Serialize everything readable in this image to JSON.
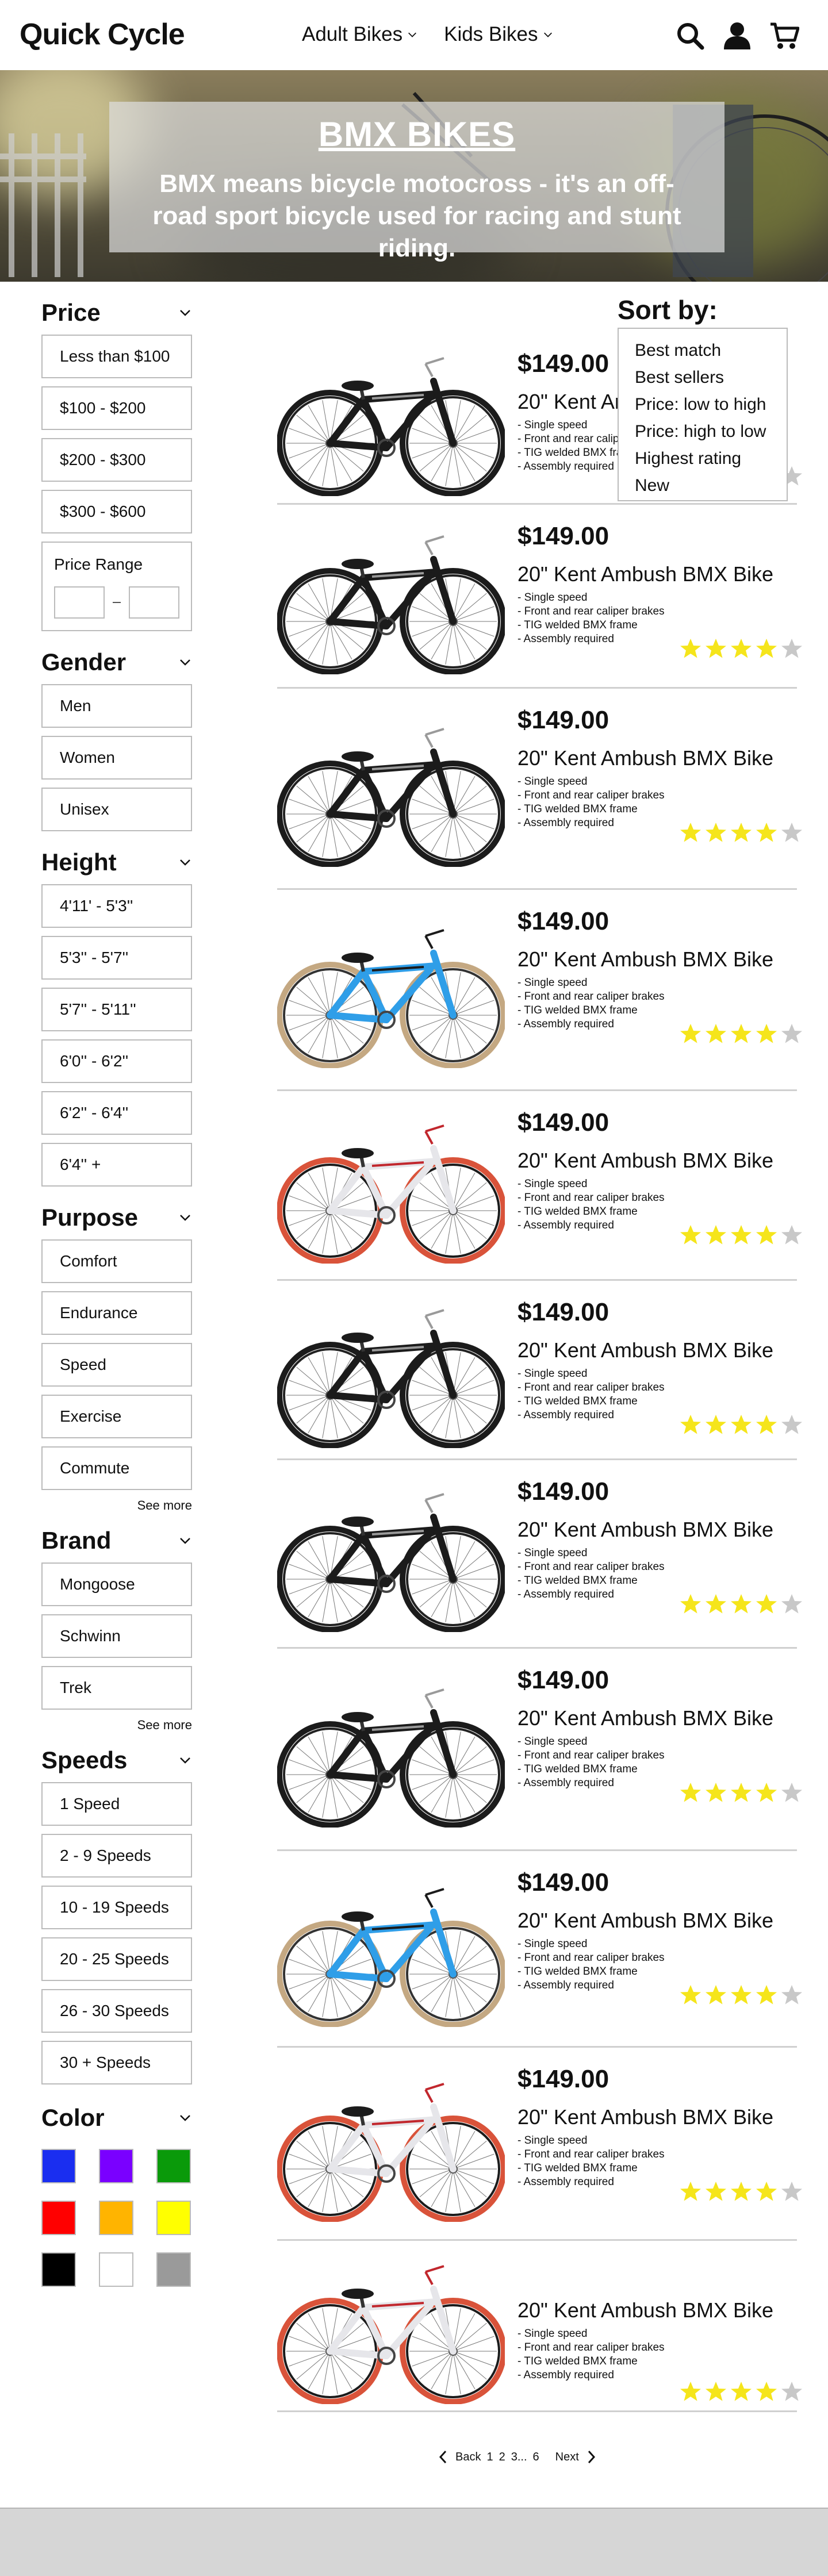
{
  "header": {
    "logo": "Quick Cycle",
    "nav": [
      {
        "label": "Adult Bikes"
      },
      {
        "label": "Kids Bikes"
      }
    ],
    "icons": [
      "search-icon",
      "user-icon",
      "cart-icon"
    ]
  },
  "hero": {
    "title": "BMX BIKES",
    "subtitle": "BMX means bicycle motocross - it's an off-road sport bicycle used for racing and stunt riding."
  },
  "filters": {
    "price": {
      "title": "Price",
      "options": [
        "Less than $100",
        "$100 - $200",
        "$200 - $300",
        "$300 - $600"
      ],
      "range_label": "Price Range"
    },
    "gender": {
      "title": "Gender",
      "options": [
        "Men",
        "Women",
        "Unisex"
      ]
    },
    "height": {
      "title": "Height",
      "options": [
        "4'11' - 5'3''",
        "5'3'' - 5'7''",
        "5'7'' - 5'11''",
        "6'0'' - 6'2''",
        "6'2'' - 6'4''",
        "6'4'' +"
      ]
    },
    "purpose": {
      "title": "Purpose",
      "options": [
        "Comfort",
        "Endurance",
        "Speed",
        "Exercise",
        "Commute"
      ],
      "see_more": "See more"
    },
    "brand": {
      "title": "Brand",
      "options": [
        "Mongoose",
        "Schwinn",
        "Trek"
      ],
      "see_more": "See more"
    },
    "speeds": {
      "title": "Speeds",
      "options": [
        "1 Speed",
        "2 - 9 Speeds",
        "10 - 19 Speeds",
        "20 - 25 Speeds",
        "26 - 30 Speeds",
        "30 + Speeds"
      ]
    },
    "color": {
      "title": "Color",
      "swatches": [
        "#1a2ef0",
        "#7a00ff",
        "#0a9a0a",
        "#ff0000",
        "#ffb400",
        "#ffff00",
        "#000000",
        "#ffffff",
        "#9a9a9a"
      ]
    }
  },
  "sort": {
    "label": "Sort by:",
    "options": [
      "Best match",
      "Best sellers",
      "Price: low to high",
      "Price: high to low",
      "Highest rating",
      "New"
    ]
  },
  "products": [
    {
      "price": "$149.00",
      "name": "20\" Kent Ambush BMX Bike",
      "features": [
        "- Single speed",
        "- Front and rear caliper brakes",
        "- TIG welded BMX frame",
        "- Assembly required"
      ],
      "rating": 4,
      "color": "black"
    },
    {
      "price": "$149.00",
      "name": "20\" Kent Ambush BMX Bike",
      "features": [
        "- Single speed",
        "- Front and rear caliper brakes",
        "- TIG welded BMX frame",
        "- Assembly required"
      ],
      "rating": 4,
      "color": "black"
    },
    {
      "price": "$149.00",
      "name": "20\" Kent Ambush BMX Bike",
      "features": [
        "- Single speed",
        "- Front and rear caliper brakes",
        "- TIG welded BMX frame",
        "- Assembly required"
      ],
      "rating": 4,
      "color": "black"
    },
    {
      "price": "$149.00",
      "name": "20\" Kent Ambush BMX Bike",
      "features": [
        "- Single speed",
        "- Front and rear caliper brakes",
        "- TIG welded BMX frame",
        "- Assembly required"
      ],
      "rating": 4,
      "color": "blue"
    },
    {
      "price": "$149.00",
      "name": "20\" Kent Ambush BMX Bike",
      "features": [
        "- Single speed",
        "- Front and rear caliper brakes",
        "- TIG welded BMX frame",
        "- Assembly required"
      ],
      "rating": 4,
      "color": "white"
    },
    {
      "price": "$149.00",
      "name": "20\" Kent Ambush BMX Bike",
      "features": [
        "- Single speed",
        "- Front and rear caliper brakes",
        "- TIG welded BMX frame",
        "- Assembly required"
      ],
      "rating": 4,
      "color": "black"
    },
    {
      "price": "$149.00",
      "name": "20\" Kent Ambush BMX Bike",
      "features": [
        "- Single speed",
        "- Front and rear caliper brakes",
        "- TIG welded BMX frame",
        "- Assembly required"
      ],
      "rating": 4,
      "color": "black"
    },
    {
      "price": "$149.00",
      "name": "20\" Kent Ambush BMX Bike",
      "features": [
        "- Single speed",
        "- Front and rear caliper brakes",
        "- TIG welded BMX frame",
        "- Assembly required"
      ],
      "rating": 4,
      "color": "black"
    },
    {
      "price": "$149.00",
      "name": "20\" Kent Ambush BMX Bike",
      "features": [
        "- Single speed",
        "- Front and rear caliper brakes",
        "- TIG welded BMX frame",
        "- Assembly required"
      ],
      "rating": 4,
      "color": "blue"
    },
    {
      "price": "$149.00",
      "name": "20\" Kent Ambush BMX Bike",
      "features": [
        "- Single speed",
        "- Front and rear caliper brakes",
        "- TIG welded BMX frame",
        "- Assembly required"
      ],
      "rating": 4,
      "color": "white"
    },
    {
      "price": "",
      "name": "20\" Kent Ambush BMX Bike",
      "features": [
        "- Single speed",
        "- Front and rear caliper brakes",
        "- TIG welded BMX frame",
        "- Assembly required"
      ],
      "rating": 4,
      "color": "white"
    }
  ],
  "pagination": {
    "back": "Back",
    "pages": [
      "1",
      "2",
      "3...",
      "6"
    ],
    "next": "Next"
  }
}
